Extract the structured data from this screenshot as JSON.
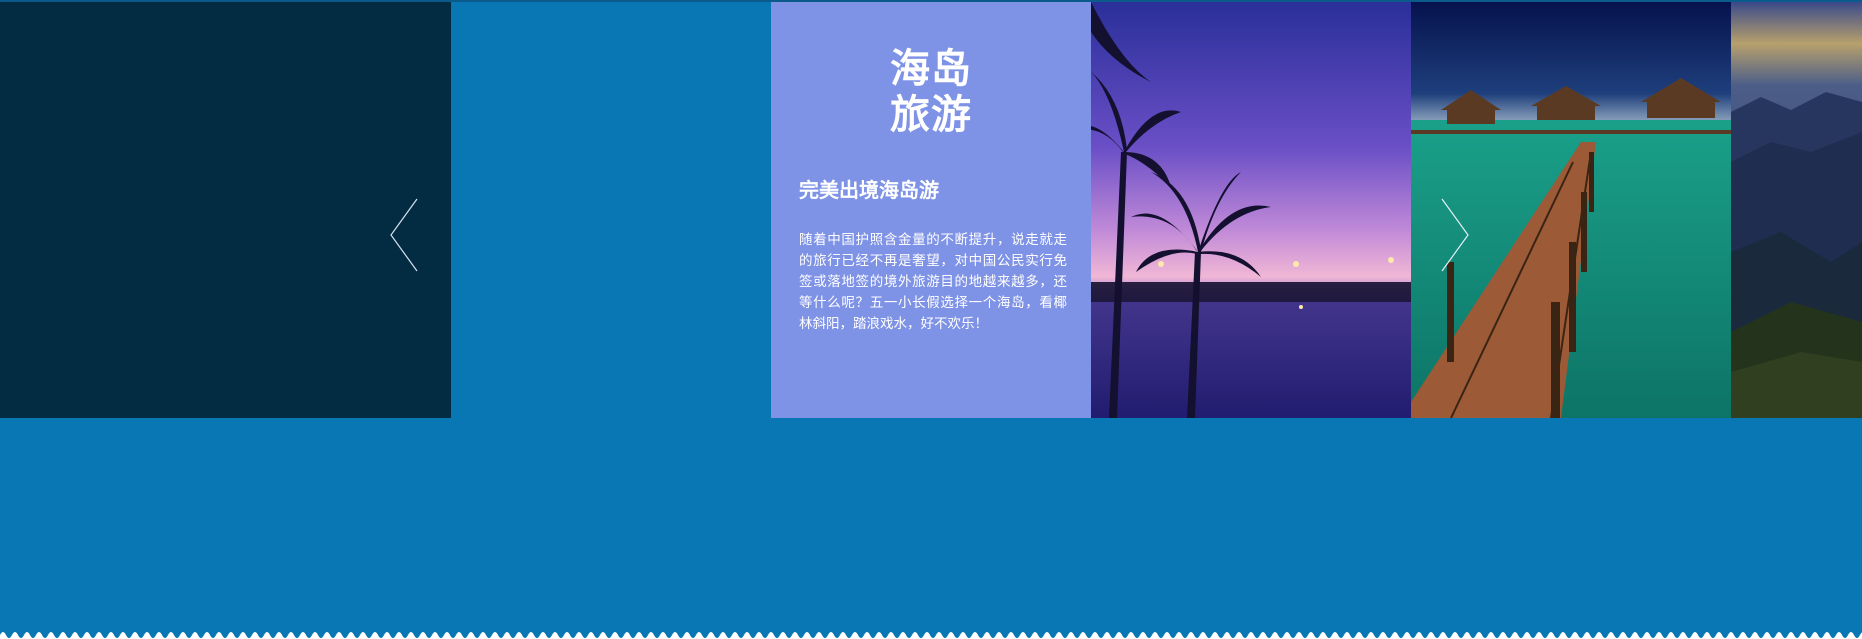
{
  "slider": {
    "card": {
      "title_line1": "海岛",
      "title_line2": "旅游",
      "subtitle": "完美出境海岛游",
      "description": "随着中国护照含金量的不断提升，说走就走的旅行已经不再是奢望，对中国公民实行免签或落地签的境外旅游目的地越来越多，还等什么呢？五一小长假选择一个海岛，看椰林斜阳，踏浪戏水，好不欢乐！"
    },
    "images": [
      "sunset-palm-pool",
      "overwater-bungalow-pier",
      "mountain-range"
    ],
    "prev_icon": "chevron-left-icon",
    "next_icon": "chevron-right-icon"
  },
  "colors": {
    "page_bg": "#0877b4",
    "dark_panel": "#032b42",
    "card_bg": "#7e92e6"
  }
}
